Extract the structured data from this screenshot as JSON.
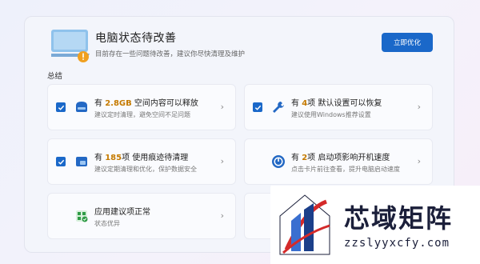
{
  "header": {
    "title": "电脑状态待改善",
    "subtitle": "目前存在一些问题待改善，建议你尽快清理及维护",
    "optimize_button": "立即优化"
  },
  "section_label": "总结",
  "cards": [
    {
      "prefix": "有 ",
      "highlight": "2.8GB",
      "suffix": " 空间内容可以释放",
      "desc": "建议定时清理，避免空间不足问题",
      "icon": "disk-icon",
      "checked": true
    },
    {
      "prefix": "有 ",
      "highlight": "4",
      "suffix": "项 默认设置可以恢复",
      "desc": "建议使用Windows推荐设置",
      "icon": "wrench-icon",
      "checked": true
    },
    {
      "prefix": "有 ",
      "highlight": "185",
      "suffix": "项 使用痕迹待清理",
      "desc": "建议定期清理和优化，保护数据安全",
      "icon": "eraser-icon",
      "checked": true
    },
    {
      "prefix": "有 ",
      "highlight": "2",
      "suffix": "项 启动项影响开机速度",
      "desc": "点击卡片前往查看，提升电脑启动速度",
      "icon": "power-icon",
      "checked": false
    },
    {
      "prefix": "",
      "highlight": "",
      "suffix": "应用建议项正常",
      "desc": "状态优异",
      "icon": "apps-check-icon",
      "checked": false
    }
  ],
  "watermark": {
    "brand": "芯域矩阵",
    "domain": "zzslyyxcfy.com"
  },
  "colors": {
    "accent": "#1a68c9",
    "highlight": "#c57a00",
    "warning": "#f0a020"
  }
}
